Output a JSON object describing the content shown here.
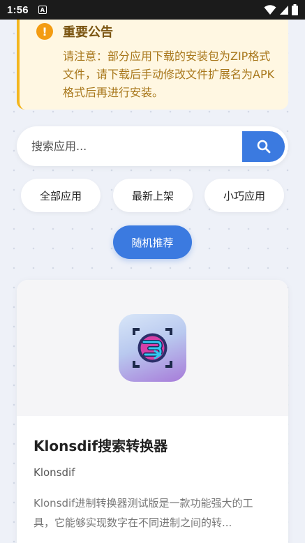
{
  "status_bar": {
    "time": "1:56",
    "app_icon_letter": "A",
    "icons": [
      "wifi-icon",
      "signal-icon",
      "battery-icon"
    ]
  },
  "notice": {
    "title": "重要公告",
    "text": "请注意：部分应用下载的安装包为ZIP格式文件，请下载后手动修改文件扩展名为APK格式后再进行安装。",
    "icon": "exclamation-icon"
  },
  "search": {
    "placeholder": "搜索应用...",
    "value": "",
    "button_icon": "search-icon"
  },
  "filters": [
    "全部应用",
    "最新上架",
    "小巧应用"
  ],
  "random_button": "随机推荐",
  "app_card": {
    "name": "Klonsdif搜索转换器",
    "developer": "Klonsdif",
    "description": "Klonsdif进制转换器测试版是一款功能强大的工具，它能够实现数字在不同进制之间的转..."
  },
  "colors": {
    "accent": "#3b7ae0",
    "notice_bg": "#fff7e2",
    "notice_border": "#f3b61f"
  }
}
